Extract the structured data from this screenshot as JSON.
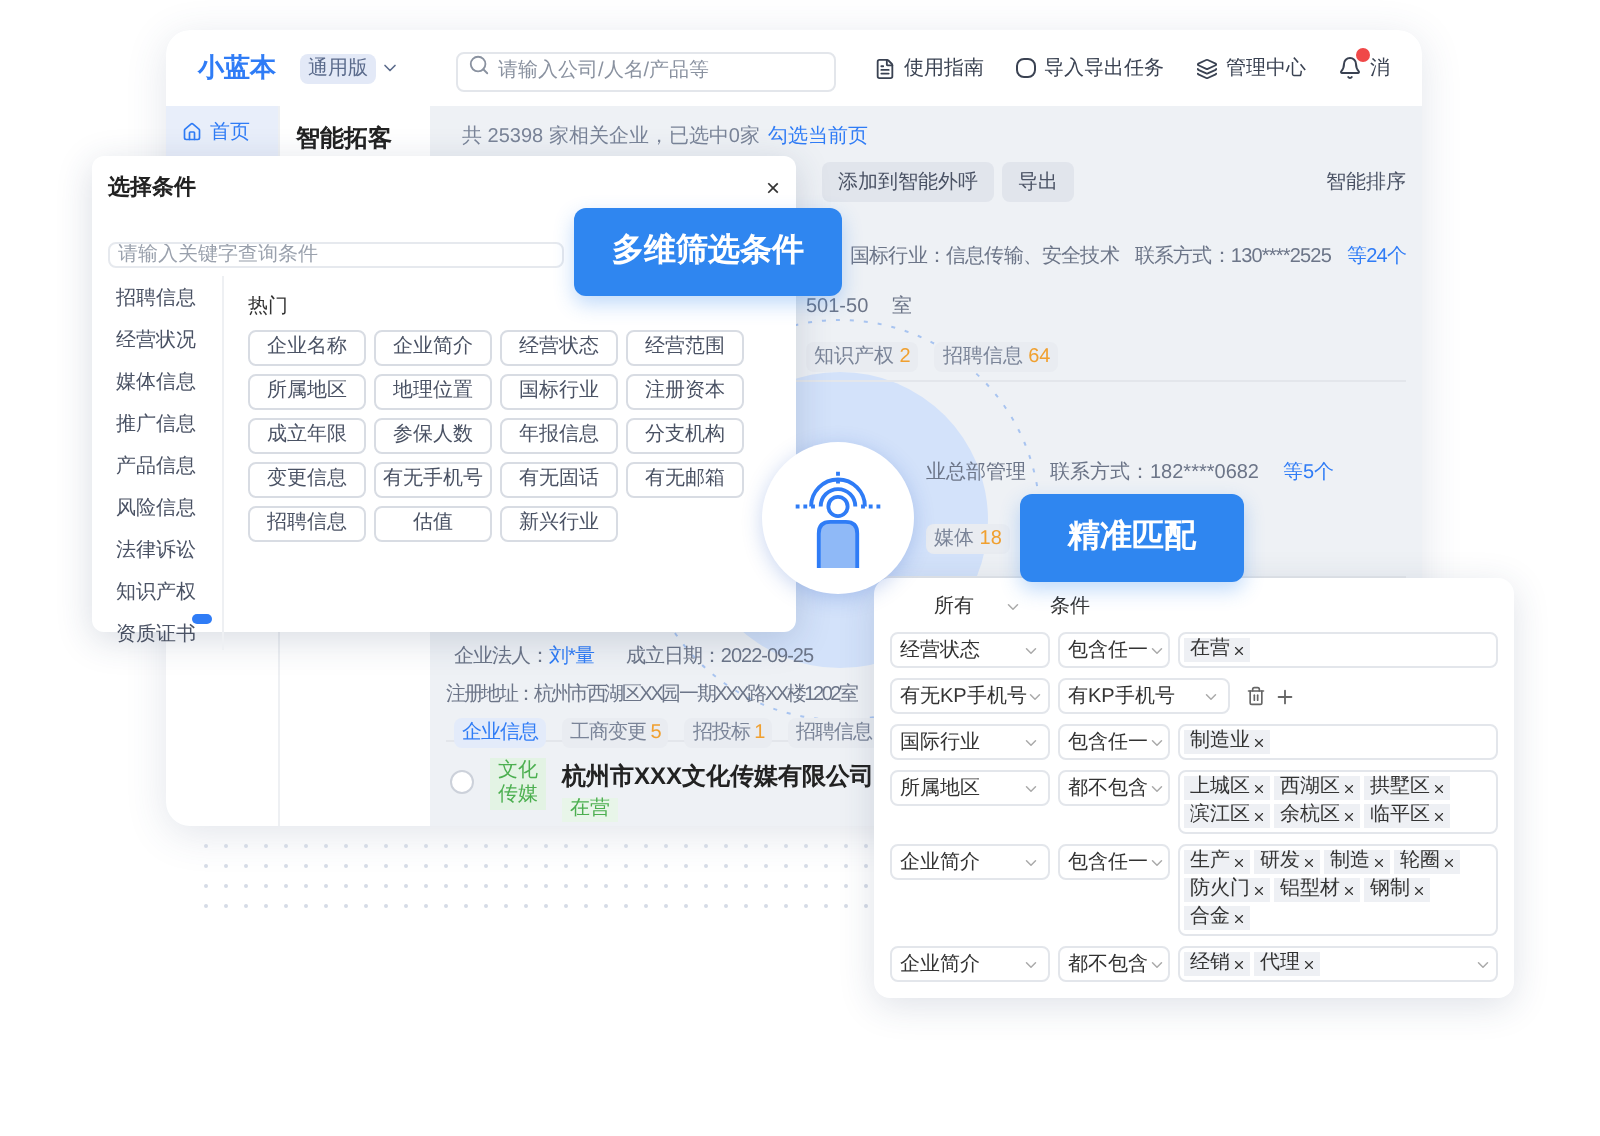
{
  "app": {
    "logo": "小蓝本",
    "edition": "通用版",
    "search": {
      "placeholder": "请输入公司/人名/产品等"
    },
    "nav": [
      "使用指南",
      "导入导出任务",
      "管理中心",
      "消"
    ],
    "has_notification": true,
    "sidebar": [
      {
        "label": "首页",
        "selected": true
      }
    ],
    "page_title": "智能拓客",
    "summary": "共 25398 家相关企业，已选中0家",
    "select_page_link": "勾选当前页",
    "toolbar": [
      "添加到智能外呼",
      "导出"
    ],
    "sort": "智能排序",
    "card_1": {
      "industry": "国标行业：信息传输、安全技术",
      "contact": "联系方式：130****2525",
      "contact_more": "等24个",
      "address_part": "501-50",
      "address_end": "室",
      "stats": [
        {
          "label": "知识产权",
          "count": "2"
        },
        {
          "label": "招聘信息",
          "count": "64"
        }
      ]
    },
    "card_2": {
      "industry_part": "业总部管理",
      "contact": "联系方式：182****0682",
      "contact_more": "等5个",
      "stats": [
        {
          "label": "媒体",
          "count": "18"
        }
      ]
    },
    "card_3": {
      "legal_label": "企业法人：",
      "legal": "刘*量",
      "date": "成立日期：2022-09-25",
      "address": "注册地址：杭州市西湖区XX园一期XXX路XX楼1202室",
      "info_tag": "企业信息",
      "stats": [
        {
          "label": "工商变更",
          "count": "5"
        },
        {
          "label": "招投标",
          "count": "1"
        },
        {
          "label": "招聘信息"
        }
      ]
    },
    "card_4": {
      "logo": "文化传媒",
      "name": "杭州市XXX文化传媒有限公司",
      "status": "在营",
      "checked": false
    }
  },
  "dialog": {
    "title": "选择条件",
    "close": "×",
    "search": {
      "placeholder": "请输入关键字查询条件"
    },
    "categories": [
      {
        "label": "招聘信息",
        "is_new": false
      },
      {
        "label": "经营状况",
        "is_new": false
      },
      {
        "label": "媒体信息",
        "is_new": false
      },
      {
        "label": "推广信息",
        "is_new": false
      },
      {
        "label": "产品信息",
        "is_new": false
      },
      {
        "label": "风险信息",
        "is_new": false
      },
      {
        "label": "法律诉讼",
        "is_new": false
      },
      {
        "label": "知识产权",
        "is_new": false
      },
      {
        "label": "资质证书",
        "is_new": true
      }
    ],
    "section": "热门",
    "options": [
      "企业名称",
      "企业简介",
      "经营状态",
      "经营范围",
      "所属地区",
      "地理位置",
      "国标行业",
      "注册资本",
      "成立年限",
      "参保人数",
      "年报信息",
      "分支机构",
      "变更信息",
      "有无手机号",
      "有无固话",
      "有无邮箱",
      "招聘信息",
      "估值",
      "新兴行业"
    ]
  },
  "callouts": [
    "多维筛选条件",
    "精准匹配"
  ],
  "conditions": {
    "match": "所有",
    "label_part": "条件",
    "rows": [
      {
        "kind": "tags",
        "field": "经营状态",
        "operator": "包含任一",
        "tags": [
          "在营"
        ],
        "dropdown": false
      },
      {
        "kind": "select",
        "field": "有无KP手机号",
        "operator": "有KP手机号",
        "tags": [],
        "dropdown": false
      },
      {
        "kind": "tags",
        "field": "国际行业",
        "operator": "包含任一",
        "tags": [
          "制造业"
        ],
        "dropdown": false
      },
      {
        "kind": "tags",
        "field": "所属地区",
        "operator": "都不包含",
        "tags": [
          "上城区",
          "西湖区",
          "拱墅区",
          "滨江区",
          "余杭区",
          "临平区"
        ],
        "dropdown": false
      },
      {
        "kind": "tags",
        "field": "企业简介",
        "operator": "包含任一",
        "tags": [
          "生产",
          "研发",
          "制造",
          "轮圈",
          "防火门",
          "铝型材",
          "钢制",
          "合金"
        ],
        "dropdown": false
      },
      {
        "kind": "tags",
        "field": "企业简介",
        "operator": "都不包含",
        "tags": [
          "经销",
          "代理"
        ],
        "dropdown": true
      }
    ]
  }
}
